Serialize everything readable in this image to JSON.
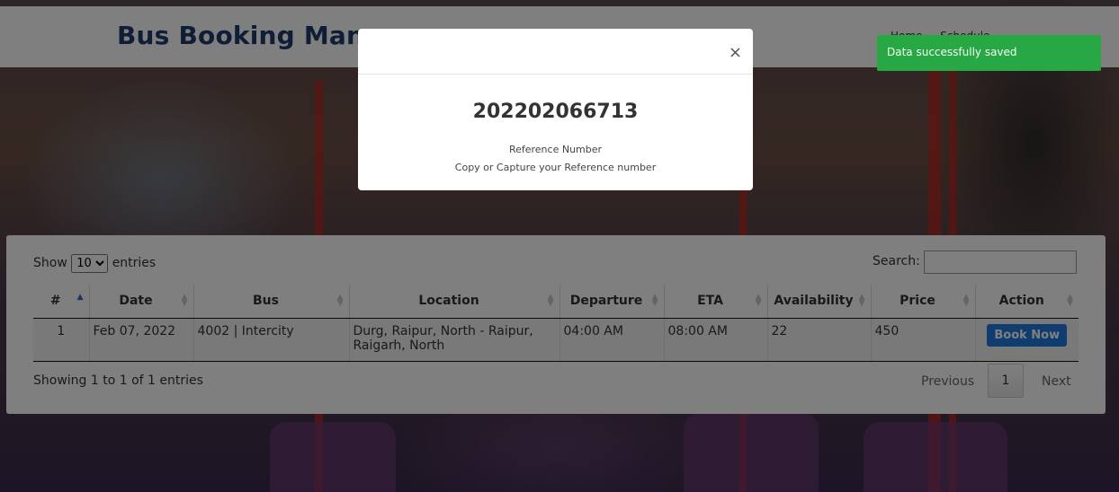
{
  "brand": {
    "title": "Bus Booking Mana"
  },
  "nav": [
    "Home",
    "Schedule"
  ],
  "table": {
    "length_label_before": "Show",
    "length_value": "10",
    "length_label_after": "entries",
    "search_label": "Search:",
    "search_value": "",
    "columns": [
      "#",
      "Date",
      "Bus",
      "Location",
      "Departure",
      "ETA",
      "Availability",
      "Price",
      "Action"
    ],
    "rows": [
      {
        "num": "1",
        "date": "Feb 07, 2022",
        "bus": "4002 | Intercity",
        "location": "Durg, Raipur, North - Raipur, Raigarh, North",
        "departure": "04:00 AM",
        "eta": "08:00 AM",
        "availability": "22",
        "price": "450",
        "action": "Book Now"
      }
    ],
    "info": "Showing 1 to 1 of 1 entries",
    "pager": {
      "previous": "Previous",
      "page": "1",
      "next": "Next"
    }
  },
  "modal": {
    "close": "×",
    "reference": "202202066713",
    "label": "Reference Number",
    "hint": "Copy or Capture your Reference number"
  },
  "toast": {
    "message": "Data successfully saved"
  },
  "colors": {
    "brand": "#1e3a6e",
    "button": "#1f7ae0",
    "toast": "#28a745"
  }
}
